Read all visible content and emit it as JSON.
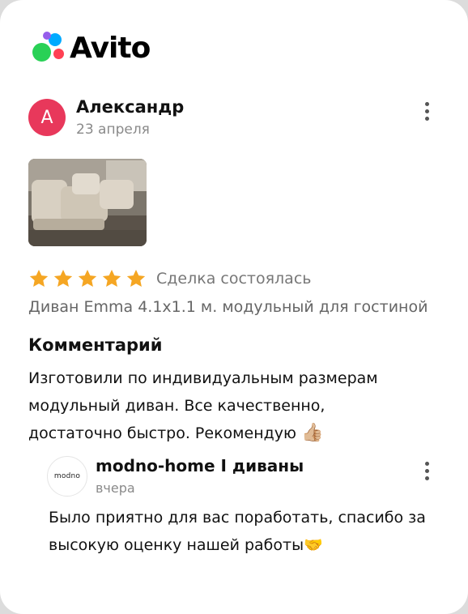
{
  "brand": {
    "name": "Avito"
  },
  "review": {
    "avatar_letter": "А",
    "author": "Александр",
    "date": "23 апреля",
    "rating": 5,
    "deal_status": "Сделка состоялась",
    "product": "Диван Emma 4.1x1.1 м. модульный для гостиной",
    "comment_title": "Комментарий",
    "comment_text": "Изготовили по индивидуальным размерам модульный диван. Все качественно, достаточно быстро. Рекомендую",
    "comment_emoji": "👍🏼"
  },
  "reply": {
    "shop_logo_text": "modno",
    "shop_name": "modno-home I диваны",
    "date": "вчера",
    "text": "Было приятно для вас поработать, спасибо за высокую оценку нашей работы",
    "emoji": "🤝"
  },
  "colors": {
    "avatar": "#e8385b",
    "star": "#f5a623",
    "muted_text": "#8a8a8a"
  }
}
